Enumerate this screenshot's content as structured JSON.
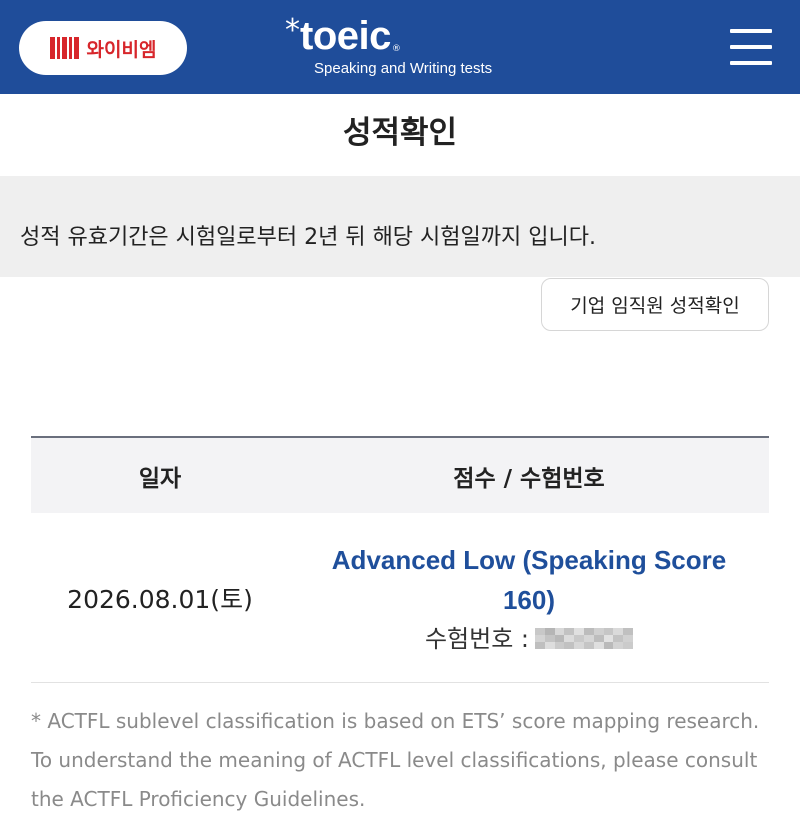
{
  "header": {
    "brand_text": "와이비엠",
    "logo_word": "toeic",
    "logo_star": "*",
    "logo_registered": "®",
    "logo_subtitle": "Speaking and Writing tests",
    "menu_icon": "hamburger-menu-icon"
  },
  "page": {
    "title": "성적확인"
  },
  "notice": {
    "text": "성적 유효기간은 시험일로부터 2년 뒤 해당 시험일까지 입니다."
  },
  "corporate_button": {
    "label": "기업 임직원 성적확인"
  },
  "table": {
    "headers": [
      "일자",
      "점수 / 수험번호"
    ],
    "rows": [
      {
        "date": "2026.08.01(토)",
        "score_line1": "Advanced Low (Speaking Score",
        "score_line2": "160)",
        "registration_label": "수험번호 :"
      }
    ]
  },
  "footnote": {
    "text": "* ACTFL sublevel classification is based on ETS’ score mapping research. To understand the meaning of ACTFL level classifications, please consult the ACTFL Proficiency Guidelines."
  },
  "colors": {
    "brand_blue": "#1f4d9a",
    "score_blue": "#1f4f9b",
    "ybm_red": "#d7262b",
    "notice_bg": "#efefef"
  }
}
